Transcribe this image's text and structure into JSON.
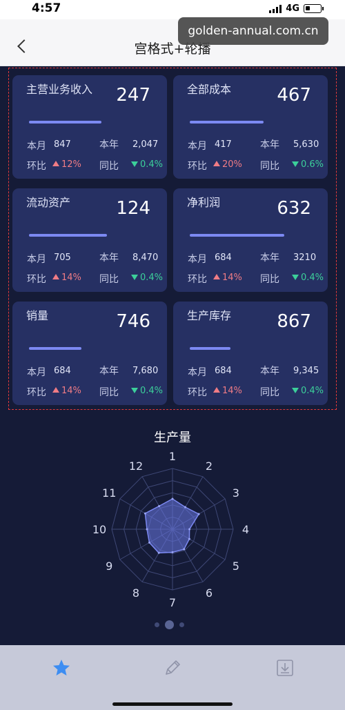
{
  "status_bar": {
    "time": "4:57",
    "network": "4G"
  },
  "nav": {
    "title": "宫格式+轮播",
    "url_overlay": "golden-annual.com.cn"
  },
  "cards": [
    {
      "title": "主营业务收入",
      "value": "247",
      "progress": 0.5,
      "month_label": "本月",
      "month_value": "847",
      "year_label": "本年",
      "year_value": "2,047",
      "mom_label": "环比",
      "mom_value": "12%",
      "mom_dir": "up",
      "yoy_label": "同比",
      "yoy_value": "0.4%",
      "yoy_dir": "down"
    },
    {
      "title": "全部成本",
      "value": "467",
      "progress": 0.51,
      "month_label": "本月",
      "month_value": "417",
      "year_label": "本年",
      "year_value": "5,630",
      "mom_label": "环比",
      "mom_value": "20%",
      "mom_dir": "up",
      "yoy_label": "同比",
      "yoy_value": "0.6%",
      "yoy_dir": "down"
    },
    {
      "title": "流动资产",
      "value": "124",
      "progress": 0.54,
      "month_label": "本月",
      "month_value": "705",
      "year_label": "本年",
      "year_value": "8,470",
      "mom_label": "环比",
      "mom_value": "14%",
      "mom_dir": "up",
      "yoy_label": "同比",
      "yoy_value": "0.4%",
      "yoy_dir": "down"
    },
    {
      "title": "净利润",
      "value": "632",
      "progress": 0.65,
      "month_label": "本月",
      "month_value": "684",
      "year_label": "本年",
      "year_value": "3210",
      "mom_label": "环比",
      "mom_value": "14%",
      "mom_dir": "up",
      "yoy_label": "同比",
      "yoy_value": "0.4%",
      "yoy_dir": "down"
    },
    {
      "title": "销量",
      "value": "746",
      "progress": 0.36,
      "month_label": "本月",
      "month_value": "684",
      "year_label": "本年",
      "year_value": "7,680",
      "mom_label": "环比",
      "mom_value": "14%",
      "mom_dir": "up",
      "yoy_label": "同比",
      "yoy_value": "0.4%",
      "yoy_dir": "down"
    },
    {
      "title": "生产库存",
      "value": "867",
      "progress": 0.28,
      "month_label": "本月",
      "month_value": "684",
      "year_label": "本年",
      "year_value": "9,345",
      "mom_label": "环比",
      "mom_value": "14%",
      "mom_dir": "up",
      "yoy_label": "同比",
      "yoy_value": "0.4%",
      "yoy_dir": "down"
    }
  ],
  "chart_data": {
    "type": "radar",
    "title": "生产量",
    "categories": [
      "1",
      "2",
      "3",
      "4",
      "5",
      "6",
      "7",
      "8",
      "9",
      "10",
      "11",
      "12"
    ],
    "max": 1,
    "series": [
      {
        "values": [
          0.5,
          0.42,
          0.5,
          0.28,
          0.32,
          0.38,
          0.38,
          0.45,
          0.44,
          0.42,
          0.52,
          0.44
        ]
      }
    ],
    "grid": true
  },
  "carousel": {
    "pages": 3,
    "active": 1
  },
  "tab_bar": {
    "items": [
      "star-icon",
      "pencil-icon",
      "download-icon"
    ],
    "active": 0
  },
  "colors": {
    "accent": "#7c89f2",
    "up": "#f07c85",
    "down": "#3ccf9a",
    "card_bg": "#263063",
    "page_bg": "#151b37"
  }
}
